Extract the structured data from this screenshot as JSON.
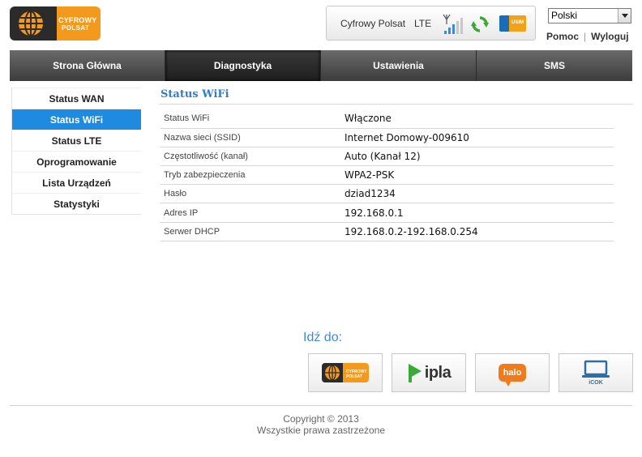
{
  "brand": {
    "name_line1": "CYFROWY",
    "name_line2": "POLSAT"
  },
  "status_bar": {
    "operator": "Cyfrowy Polsat",
    "network": "LTE",
    "sim_label": "USIM"
  },
  "language": {
    "selected": "Polski"
  },
  "top_links": {
    "help": "Pomoc",
    "logout": "Wyloguj"
  },
  "nav": {
    "tabs": [
      {
        "label": "Strona Główna",
        "active": false
      },
      {
        "label": "Diagnostyka",
        "active": true
      },
      {
        "label": "Ustawienia",
        "active": false
      },
      {
        "label": "SMS",
        "active": false
      }
    ]
  },
  "sidebar": {
    "items": [
      {
        "label": "Status WAN",
        "active": false
      },
      {
        "label": "Status WiFi",
        "active": true
      },
      {
        "label": "Status LTE",
        "active": false
      },
      {
        "label": "Oprogramowanie",
        "active": false
      },
      {
        "label": "Lista Urządzeń",
        "active": false
      },
      {
        "label": "Statystyki",
        "active": false
      }
    ]
  },
  "content": {
    "title": "Status WiFi",
    "rows": [
      {
        "label": "Status WiFi",
        "value": "Włączone"
      },
      {
        "label": "Nazwa sieci (SSID)",
        "value": "Internet Domowy-009610"
      },
      {
        "label": "Częstotliwość (kanał)",
        "value": "Auto (Kanał 12)"
      },
      {
        "label": "Tryb zabezpieczenia",
        "value": "WPA2-PSK"
      },
      {
        "label": "Hasło",
        "value": "dziad1234"
      },
      {
        "label": "Adres IP",
        "value": "192.168.0.1"
      },
      {
        "label": "Serwer DHCP",
        "value": "192.168.0.2-192.168.0.254"
      }
    ]
  },
  "goto": {
    "label": "Idź do:",
    "links": {
      "polsat_line1": "CYFROWY",
      "polsat_line2": "POLSAT",
      "ipla": "ipla",
      "halo": "halo",
      "icok": "iCOK"
    }
  },
  "footer": {
    "copyright": "Copyright © 2013",
    "rights": "Wszystkie prawa zastrzeżone"
  },
  "colors": {
    "accent_blue": "#1e8be0",
    "brand_orange": "#f39a1c",
    "nav_dark": "#3c3c3c"
  }
}
